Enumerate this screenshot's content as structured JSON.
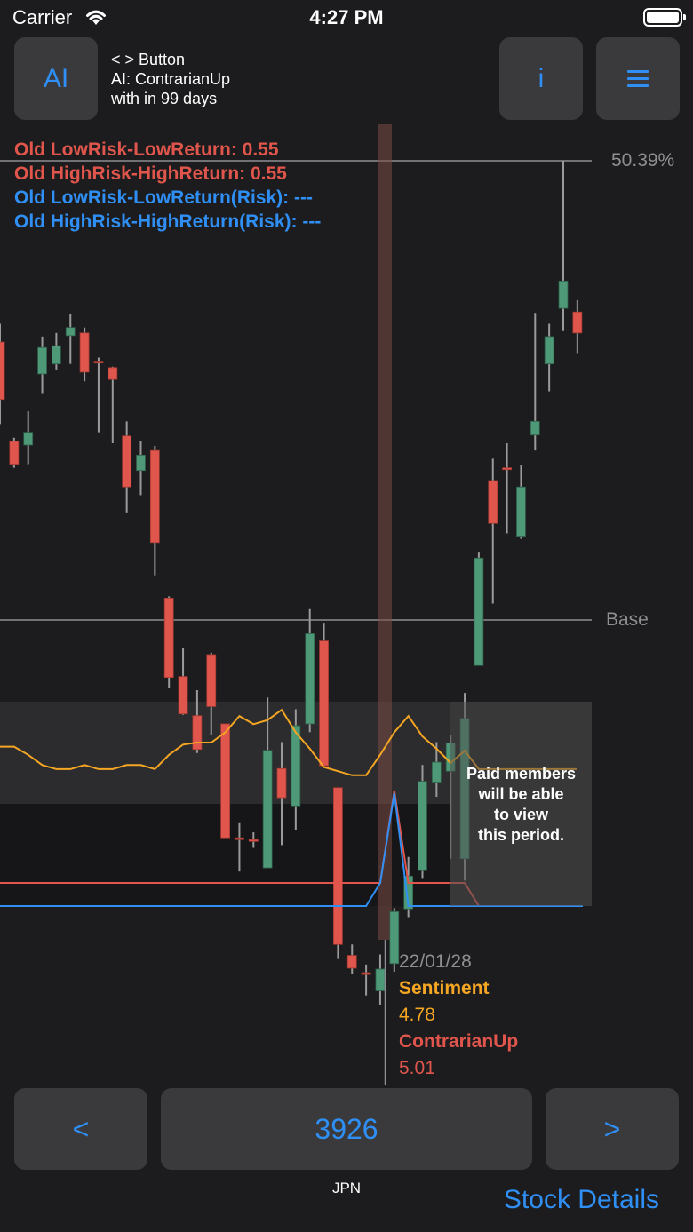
{
  "status": {
    "carrier": "Carrier",
    "time": "4:27 PM"
  },
  "header": {
    "ai_button": "AI",
    "info_button": "i",
    "info_lines": [
      "< > Button",
      "AI: ContrarianUp",
      "with in 99 days"
    ]
  },
  "legend": {
    "line1": "Old LowRisk-LowReturn: 0.55",
    "line2": "Old HighRisk-HighReturn: 0.55",
    "line3": "Old LowRisk-LowReturn(Risk): ---",
    "line4": "Old HighRisk-HighReturn(Risk): ---"
  },
  "chart_labels": {
    "top": "50.39%",
    "base": "Base"
  },
  "paid_notice": [
    "Paid members",
    "will be able",
    "to view",
    "this period."
  ],
  "tooltip": {
    "date": "22/01/28",
    "series1_name": "Sentiment",
    "series1_value": "4.78",
    "series2_name": "ContrarianUp",
    "series2_value": "5.01"
  },
  "nav": {
    "prev": "<",
    "code": "3926",
    "next": ">",
    "market": "JPN"
  },
  "footer": {
    "stock_details": "Stock Details"
  },
  "colors": {
    "up": "#4e9a78",
    "down": "#e0564c",
    "accent": "#2f8ff5",
    "sentiment": "#f5a623"
  },
  "chart_data": {
    "type": "candlestick",
    "top_label": "50.39%",
    "base_label": "Base",
    "candles": [
      {
        "o": 30.5,
        "c": 24.2,
        "h": 32.5,
        "l": 21.5
      },
      {
        "o": 19.6,
        "c": 17.1,
        "h": 20.0,
        "l": 16.7
      },
      {
        "o": 19.2,
        "c": 20.6,
        "h": 22.9,
        "l": 17.1
      },
      {
        "o": 27.0,
        "c": 29.9,
        "h": 31.1,
        "l": 24.8
      },
      {
        "o": 28.1,
        "c": 30.1,
        "h": 31.5,
        "l": 27.5
      },
      {
        "o": 31.2,
        "c": 32.1,
        "h": 33.6,
        "l": 28.1
      },
      {
        "o": 31.5,
        "c": 27.2,
        "h": 32.1,
        "l": 26.2
      },
      {
        "o": 28.4,
        "c": 28.2,
        "h": 28.8,
        "l": 20.6
      },
      {
        "o": 27.7,
        "c": 26.4,
        "h": 27.8,
        "l": 19.4
      },
      {
        "o": 20.2,
        "c": 14.6,
        "h": 21.8,
        "l": 11.8
      },
      {
        "o": 16.4,
        "c": 18.1,
        "h": 19.6,
        "l": 13.7
      },
      {
        "o": 18.6,
        "c": 8.5,
        "h": 19.1,
        "l": 4.9
      },
      {
        "o": 2.4,
        "c": -6.3,
        "h": 2.6,
        "l": -7.5
      },
      {
        "o": -6.2,
        "c": -10.3,
        "h": -3.1,
        "l": -10.4
      },
      {
        "o": -10.5,
        "c": -14.2,
        "h": -7.7,
        "l": -14.6
      },
      {
        "o": -3.8,
        "c": -9.5,
        "h": -3.6,
        "l": -12.6
      },
      {
        "o": -11.4,
        "c": -23.9,
        "h": -11.4,
        "l": -23.9
      },
      {
        "o": -23.9,
        "c": -24.0,
        "h": -22.2,
        "l": -27.6
      },
      {
        "o": -24.1,
        "c": -24.2,
        "h": -23.3,
        "l": -25.0
      },
      {
        "o": -27.2,
        "c": -14.3,
        "h": -8.5,
        "l": -27.2
      },
      {
        "o": -16.3,
        "c": -19.5,
        "h": -13.4,
        "l": -24.7
      },
      {
        "o": -20.4,
        "c": -11.6,
        "h": -9.8,
        "l": -23.0
      },
      {
        "o": -11.4,
        "c": -1.5,
        "h": 1.2,
        "l": -12.3
      },
      {
        "o": -2.3,
        "c": -16.0,
        "h": -0.3,
        "l": -16.0
      },
      {
        "o": -18.4,
        "c": -35.6,
        "h": -18.4,
        "l": -37.2
      },
      {
        "o": -36.8,
        "c": -38.2,
        "h": -35.6,
        "l": -38.8
      },
      {
        "o": -38.7,
        "c": -38.9,
        "h": -37.8,
        "l": -41.2
      },
      {
        "o": -40.7,
        "c": -38.3,
        "h": -36.7,
        "l": -42.2
      },
      {
        "o": -37.7,
        "c": -32.0,
        "h": -31.6,
        "l": -38.6
      },
      {
        "o": -31.7,
        "c": -28.1,
        "h": -26.0,
        "l": -32.6
      },
      {
        "o": -27.5,
        "c": -17.7,
        "h": -15.9,
        "l": -28.4
      },
      {
        "o": -17.8,
        "c": -15.6,
        "h": -13.4,
        "l": -19.4
      },
      {
        "o": -16.6,
        "c": -13.5,
        "h": -12.6,
        "l": -26.2
      },
      {
        "o": -26.2,
        "c": -10.8,
        "h": -8.0,
        "l": -28.6
      },
      {
        "o": -5.0,
        "c": 6.8,
        "h": 7.4,
        "l": -5.0
      },
      {
        "o": 15.3,
        "c": 10.6,
        "h": 17.7,
        "l": 1.8
      },
      {
        "o": 16.7,
        "c": 16.5,
        "h": 19.4,
        "l": 9.5
      },
      {
        "o": 9.2,
        "c": 14.6,
        "h": 17.0,
        "l": 8.9
      },
      {
        "o": 20.3,
        "c": 21.8,
        "h": 33.7,
        "l": 18.6
      },
      {
        "o": 28.1,
        "c": 31.1,
        "h": 32.5,
        "l": 25.1
      },
      {
        "o": 34.2,
        "c": 37.2,
        "h": 50.39,
        "l": 31.7
      },
      {
        "o": 33.8,
        "c": 31.5,
        "h": 35.1,
        "l": 29.3
      }
    ],
    "sentiment": [
      5.8,
      5.8,
      5.4,
      4.9,
      4.7,
      4.7,
      4.9,
      4.7,
      4.7,
      4.9,
      4.9,
      4.7,
      5.4,
      5.9,
      6.0,
      6.0,
      6.5,
      7.3,
      6.9,
      7.1,
      7.6,
      6.5,
      5.7,
      4.8,
      4.6,
      4.4,
      4.4,
      5.4,
      6.5,
      7.3,
      6.3,
      5.7,
      5.0,
      5.6,
      4.7,
      4.7,
      4.7,
      4.7,
      4.7,
      4.7,
      4.7,
      4.7
    ],
    "risk_low": [
      0,
      0,
      0,
      0,
      0,
      0,
      0,
      0,
      0,
      0,
      0,
      0,
      0,
      0,
      0,
      0,
      0,
      0,
      0,
      0,
      0,
      0,
      0,
      0,
      0,
      0,
      0,
      1,
      4.9,
      0,
      0,
      0,
      0,
      0,
      0,
      0,
      0,
      0,
      0,
      0,
      0,
      0
    ],
    "risk_high": [
      1,
      1,
      1,
      1,
      1,
      1,
      1,
      1,
      1,
      1,
      1,
      1,
      1,
      1,
      1,
      1,
      1,
      1,
      1,
      1,
      1,
      1,
      1,
      1,
      1,
      1,
      1,
      1,
      5.01,
      1,
      1,
      1,
      1,
      1,
      0,
      0,
      0,
      0,
      0,
      0,
      0,
      0
    ],
    "selected_date": "22/01/28",
    "locked_from_index": 34
  }
}
